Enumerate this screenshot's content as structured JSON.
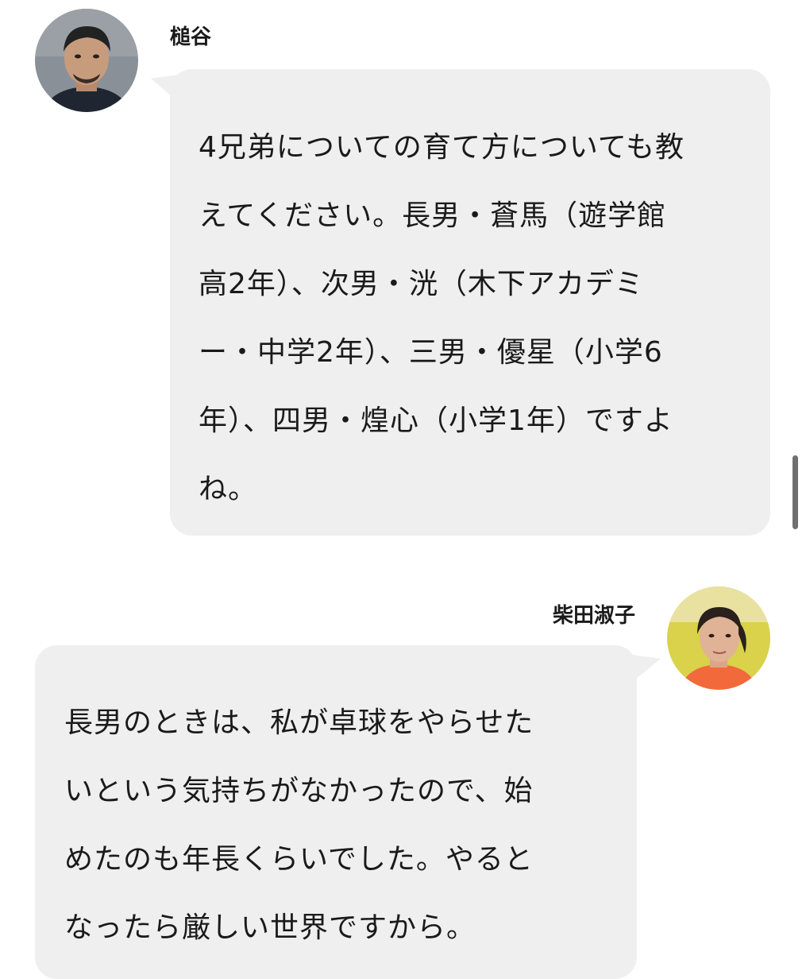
{
  "messages": [
    {
      "speaker": "槌谷",
      "side": "left",
      "lines": [
        "4兄弟についての育て方についても教",
        "えてください。長男・蒼馬（遊学館",
        "高2年）、次男・洸（木下アカデミ",
        "ー・中学2年）、三男・優星（小学6",
        "年）、四男・煌心（小学1年）ですよ",
        "ね。"
      ]
    },
    {
      "speaker": "柴田淑子",
      "side": "right",
      "lines": [
        "長男のときは、私が卓球をやらせた",
        "いという気持ちがなかったので、始",
        "めたのも年長くらいでした。やると",
        "なったら厳しい世界ですから。"
      ]
    }
  ],
  "colors": {
    "bubble": "#efefef",
    "text": "#1a1a1a",
    "scrollbar": "#6f6f6f"
  }
}
